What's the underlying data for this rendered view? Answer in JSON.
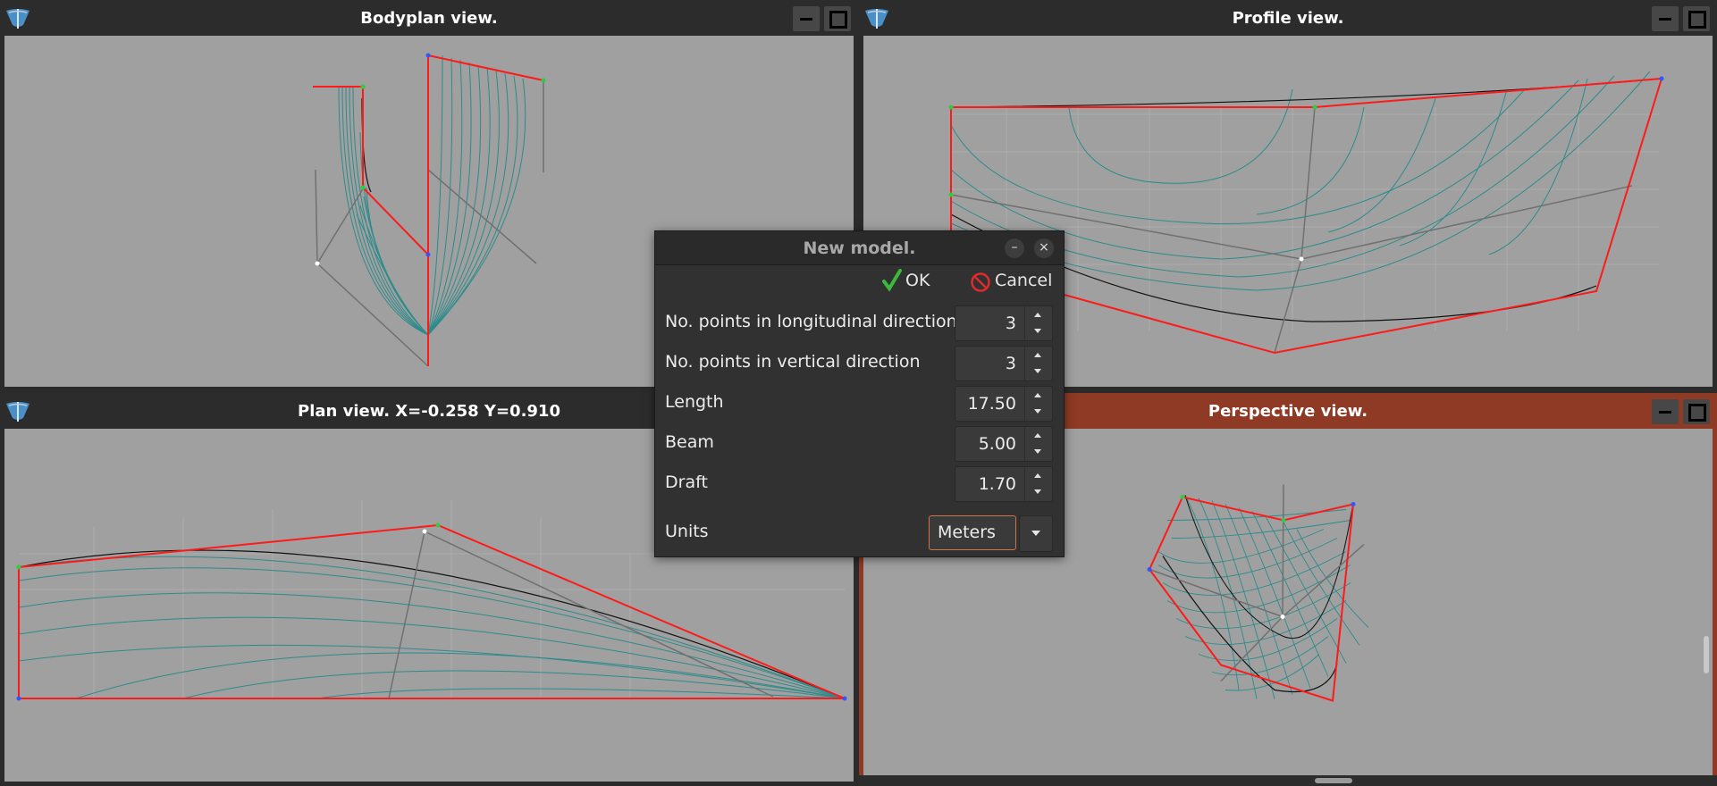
{
  "views": {
    "bodyplan": {
      "title": "Bodyplan view."
    },
    "profile": {
      "title": "Profile view."
    },
    "plan": {
      "title": "Plan view.  X=-0.258  Y=0.910"
    },
    "perspective": {
      "title": "Perspective view."
    }
  },
  "dialog": {
    "title": "New model.",
    "minimize_label": "–",
    "close_label": "×",
    "ok_label": "OK",
    "cancel_label": "Cancel",
    "fields": [
      {
        "label": "No. points in longitudinal direction",
        "value": "3"
      },
      {
        "label": "No. points in vertical direction",
        "value": "3"
      },
      {
        "label": "Length",
        "value": "17.50"
      },
      {
        "label": "Beam",
        "value": "5.00"
      },
      {
        "label": "Draft",
        "value": "1.70"
      }
    ],
    "units_label": "Units",
    "units_value": "Meters"
  },
  "colors": {
    "accent": "#8e3a24",
    "control_net": "#ff1a1a",
    "surface_lines": "#2e8b8b",
    "canvas_bg": "#a0a0a0"
  },
  "icons": {
    "app": "hull-app-icon",
    "ok": "checkmark-icon",
    "cancel": "no-entry-icon"
  }
}
